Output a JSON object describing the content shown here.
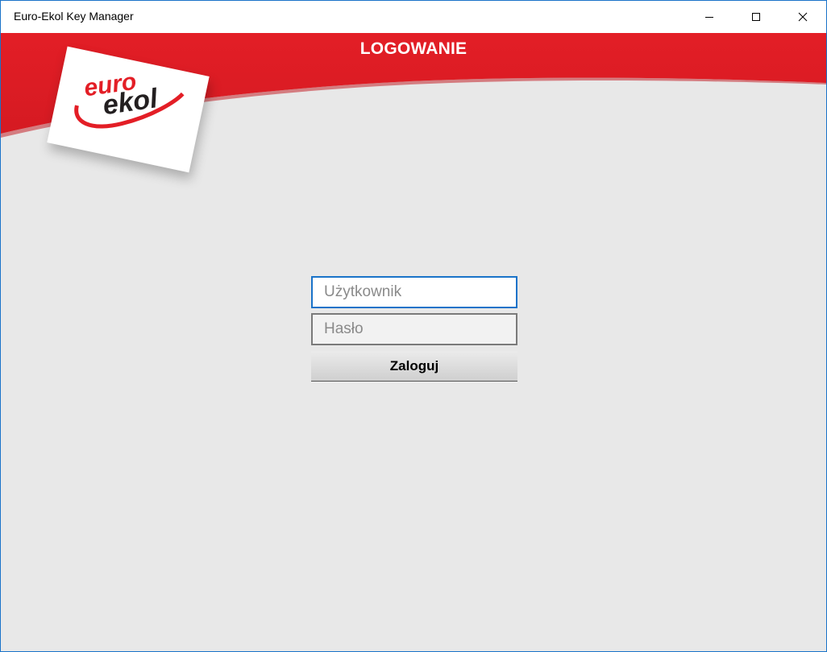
{
  "window": {
    "title": "Euro-Ekol Key Manager",
    "controls": {
      "minimize_icon": "minimize-icon",
      "maximize_icon": "maximize-icon",
      "close_icon": "close-icon"
    }
  },
  "header": {
    "title": "LOGOWANIE",
    "brand_color": "#e31e26"
  },
  "logo": {
    "text_top": "euro",
    "text_bottom": "ekol"
  },
  "login": {
    "username": {
      "value": "",
      "placeholder": "Użytkownik"
    },
    "password": {
      "value": "",
      "placeholder": "Hasło"
    },
    "submit_label": "Zaloguj"
  },
  "colors": {
    "focus_border": "#1a73c9",
    "background": "#e8e8e8"
  }
}
